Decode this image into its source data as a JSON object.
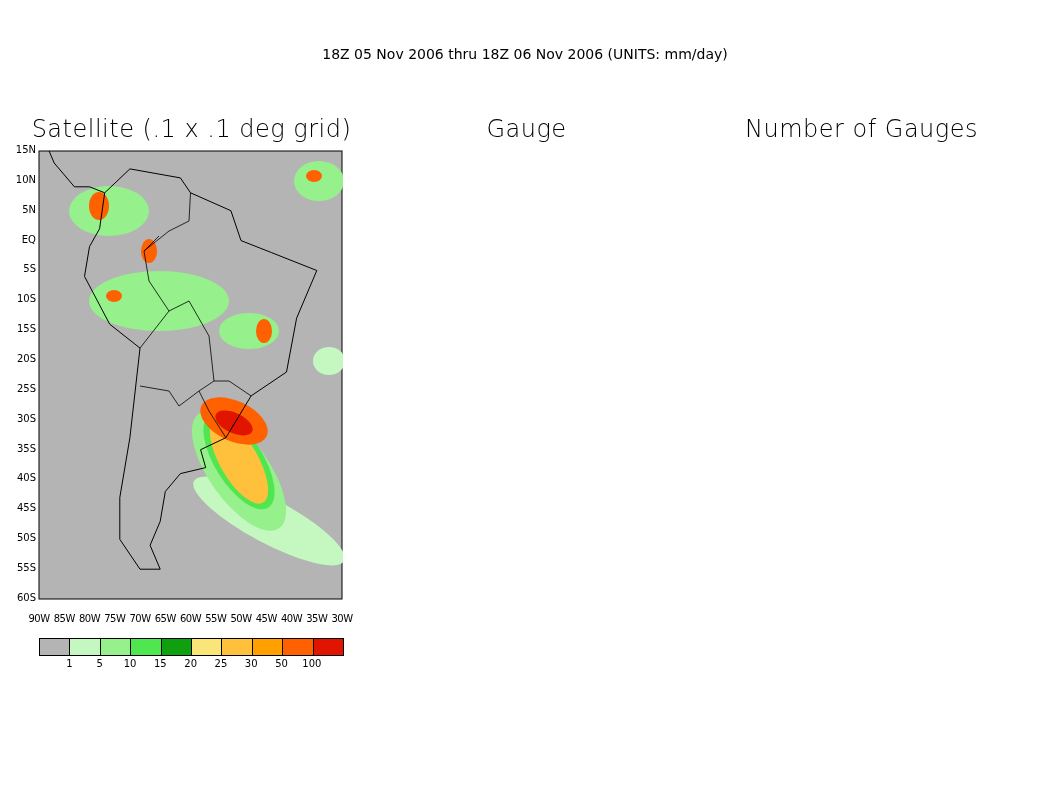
{
  "header": {
    "title": "18Z 05 Nov 2006 thru 18Z 06 Nov 2006 (UNITS: mm/day)"
  },
  "panels": [
    {
      "title": "Satellite (.1 x .1 deg grid)",
      "kind": "map",
      "lat_labels": [
        "15N",
        "10N",
        "5N",
        "EQ",
        "5S",
        "10S",
        "15S",
        "20S",
        "25S",
        "30S",
        "35S",
        "40S",
        "45S",
        "50S",
        "55S",
        "60S"
      ],
      "lon_labels": [
        "90W",
        "85W",
        "80W",
        "75W",
        "70W",
        "65W",
        "60W",
        "55W",
        "50W",
        "45W",
        "40W",
        "35W",
        "30W"
      ],
      "legend": {
        "colors": [
          {
            "color": "#b4b4b4"
          },
          {
            "color": "#c4f8c0"
          },
          {
            "color": "#96f08c"
          },
          {
            "color": "#50e650"
          },
          {
            "color": "#0fa00f"
          },
          {
            "color": "#fae678"
          },
          {
            "color": "#ffc03c"
          },
          {
            "color": "#ffa000"
          },
          {
            "color": "#ff6000"
          },
          {
            "color": "#e11400"
          }
        ],
        "labels": [
          "1",
          "5",
          "10",
          "15",
          "20",
          "25",
          "30",
          "50",
          "100"
        ]
      }
    },
    {
      "title": "Gauge",
      "kind": "empty"
    },
    {
      "title": "Number of Gauges",
      "kind": "empty"
    }
  ]
}
